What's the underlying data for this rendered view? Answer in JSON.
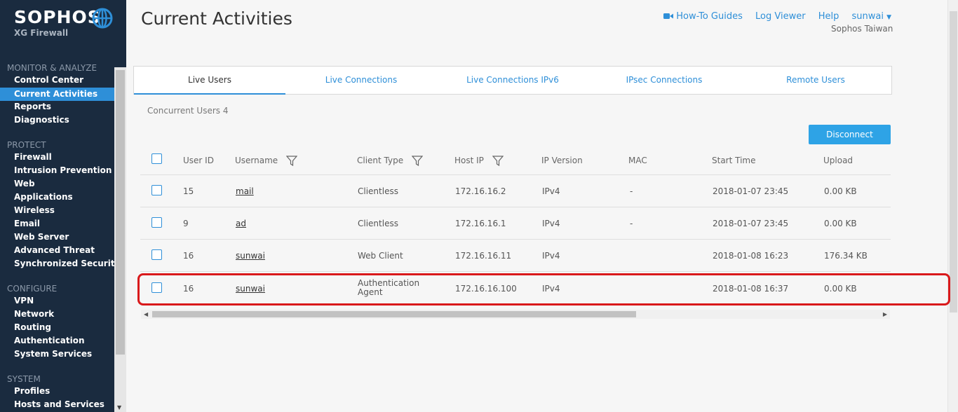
{
  "brand": {
    "name": "SOPHOS",
    "product": "XG Firewall"
  },
  "page": {
    "title": "Current Activities"
  },
  "header": {
    "links": [
      "How-To Guides",
      "Log Viewer",
      "Help"
    ],
    "user": "sunwai",
    "org": "Sophos Taiwan"
  },
  "sidebar": {
    "sections": [
      {
        "title": "MONITOR & ANALYZE",
        "items": [
          "Control Center",
          "Current Activities",
          "Reports",
          "Diagnostics"
        ]
      },
      {
        "title": "PROTECT",
        "items": [
          "Firewall",
          "Intrusion Prevention",
          "Web",
          "Applications",
          "Wireless",
          "Email",
          "Web Server",
          "Advanced Threat",
          "Synchronized Security"
        ]
      },
      {
        "title": "CONFIGURE",
        "items": [
          "VPN",
          "Network",
          "Routing",
          "Authentication",
          "System Services"
        ]
      },
      {
        "title": "SYSTEM",
        "items": [
          "Profiles",
          "Hosts and Services"
        ]
      }
    ],
    "active": "Current Activities"
  },
  "tabs": [
    "Live Users",
    "Live Connections",
    "Live Connections IPv6",
    "IPsec Connections",
    "Remote Users"
  ],
  "active_tab": "Live Users",
  "concurrent_users": "Concurrent Users 4",
  "disconnect_label": "Disconnect",
  "table": {
    "columns": [
      "User ID",
      "Username",
      "Client Type",
      "Host IP",
      "IP Version",
      "MAC",
      "Start Time",
      "Upload"
    ],
    "rows": [
      {
        "user_id": "15",
        "username": "mail",
        "client_type": "Clientless",
        "client_type_2": "",
        "host_ip": "172.16.16.2",
        "ip_version": "IPv4",
        "mac": "-",
        "start_time": "2018-01-07 23:45",
        "upload": "0.00 KB"
      },
      {
        "user_id": "9",
        "username": "ad",
        "client_type": "Clientless",
        "client_type_2": "",
        "host_ip": "172.16.16.1",
        "ip_version": "IPv4",
        "mac": "-",
        "start_time": "2018-01-07 23:45",
        "upload": "0.00 KB"
      },
      {
        "user_id": "16",
        "username": "sunwai",
        "client_type": "Web Client",
        "client_type_2": "",
        "host_ip": "172.16.16.11",
        "ip_version": "IPv4",
        "mac": "",
        "start_time": "2018-01-08 16:23",
        "upload": "176.34 KB"
      },
      {
        "user_id": "16",
        "username": "sunwai",
        "client_type": "Authentication",
        "client_type_2": "Agent",
        "host_ip": "172.16.16.100",
        "ip_version": "IPv4",
        "mac": "",
        "start_time": "2018-01-08 16:37",
        "upload": "0.00 KB"
      }
    ]
  },
  "colors": {
    "sidebar_bg": "#1a2b3f",
    "accent": "#2e8fd8",
    "highlight": "#d9191b",
    "button": "#2ea3e6"
  }
}
